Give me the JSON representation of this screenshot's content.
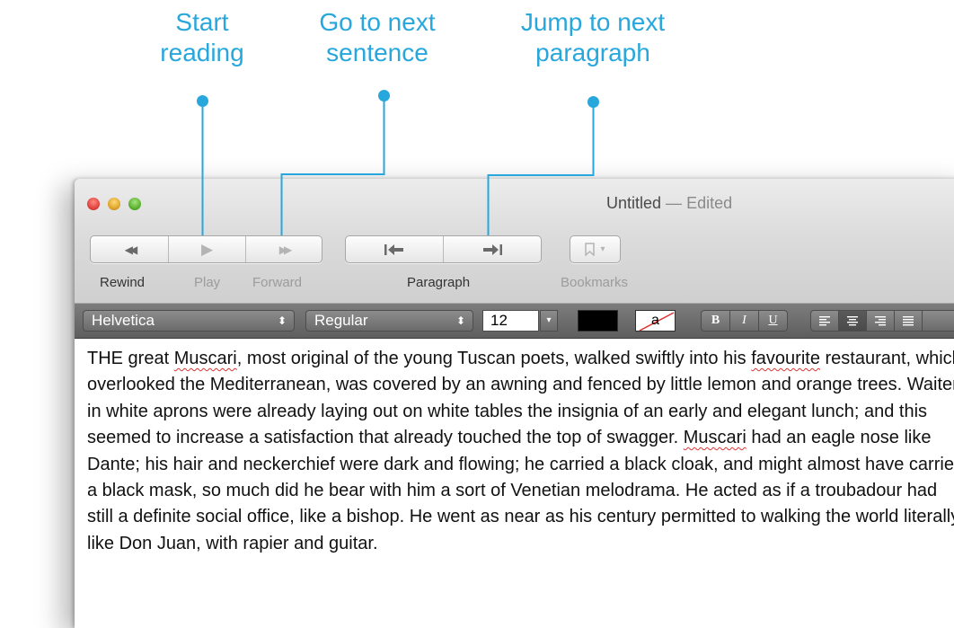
{
  "callouts": [
    {
      "line1": "Start",
      "line2": "reading"
    },
    {
      "line1": "Go to next",
      "line2": "sentence"
    },
    {
      "line1": "Jump to next",
      "line2": "paragraph"
    }
  ],
  "window": {
    "title": "Untitled",
    "title_separator": "—",
    "title_status": "Edited"
  },
  "toolbar": {
    "rewind_label": "Rewind",
    "play_label": "Play",
    "forward_label": "Forward",
    "paragraph_label": "Paragraph",
    "bookmarks_label": "Bookmarks",
    "rewind_icon": "◀◀",
    "play_icon": "▶",
    "forward_icon": "▶▶",
    "bookmark_arrow": "▾"
  },
  "format_bar": {
    "font_family": "Helvetica",
    "font_style": "Regular",
    "font_size": "12",
    "popup_arrow": "⬍",
    "size_arrow": "▾",
    "text_color": "#000000",
    "background_swatch_glyph": "a",
    "bold_label": "B",
    "italic_label": "I",
    "underline_label": "U"
  },
  "document": {
    "text_before_1": "THE great ",
    "misspelled_1": "Muscari",
    "text_after_1": ", most original of the young Tuscan poets, walked swiftly into his ",
    "misspelled_2": "favourite",
    "text_after_2": " restaurant, which overlooked the Mediterranean, was covered by an awning and fenced by little lemon and orange trees. Waiters in white aprons were already laying out on white tables the insignia of an early and elegant lunch; and this seemed to increase a satisfaction that already touched the top of swagger. ",
    "misspelled_3": "Muscari",
    "text_after_3": " had an eagle nose like Dante; his hair and neckerchief were dark and flowing; he carried a black cloak, and might almost have carried a black mask, so much did he bear with him a sort of Venetian melodrama. He acted as if a troubadour had still a definite social office, like a bishop. He went as near as his century permitted to walking the world literally like Don Juan, with rapier and guitar."
  },
  "colors": {
    "callout_accent": "#27a7dc",
    "spelling_underline": "#dd3333"
  }
}
